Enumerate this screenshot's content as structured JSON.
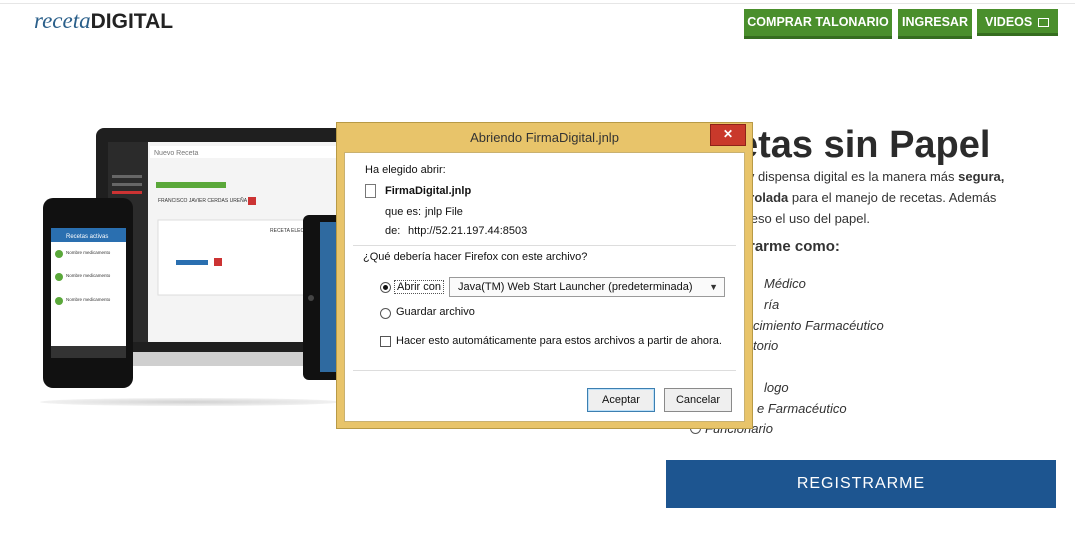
{
  "header": {
    "logo_italic": "receta",
    "logo_bold": "DIGITAL",
    "nav": [
      {
        "label": "COMPRAR TALONARIO"
      },
      {
        "label": "INGRESAR"
      },
      {
        "label": "VIDEOS"
      }
    ]
  },
  "hero": {
    "title": "etas sin Papel",
    "desc_1": "n y dispensa digital es la manera más ",
    "desc_bold_1": "segura,",
    "desc_bold_2": "ntrolada",
    "desc_2": " para el manejo de recetas. Además",
    "desc_3": "oceso el uso del papel."
  },
  "register": {
    "heading": "trarme como:",
    "options": [
      "Médico",
      "ría",
      "cimiento Farmacéutico",
      "torio",
      "logo",
      "e Farmacéutico",
      "Funcionario"
    ],
    "button_label": "REGISTRARME"
  },
  "mockup": {
    "app_header": "Nuevo Receta",
    "patient_name": "FRANCISCO JAVIER CERDAS UREÑA",
    "panel_title": "RECETA ELECTR",
    "phone_header": "Recetas activas",
    "phone_item_label": "Nombre medicamento"
  },
  "dialog": {
    "title": "Abriendo FirmaDigital.jnlp",
    "close_glyph": "✕",
    "chose_to_open": "Ha elegido abrir:",
    "filename": "FirmaDigital.jnlp",
    "type_label": "que es:",
    "type_value": "jnlp File",
    "from_label": "de:",
    "from_value": "http://52.21.197.44:8503",
    "question": "¿Qué debería hacer Firefox con este archivo?",
    "open_with_label": "Abrir con",
    "open_with_app": "Java(TM) Web Start Launcher (predeterminada)",
    "save_label": "Guardar archivo",
    "auto_label": "Hacer esto automáticamente para estos archivos a partir de ahora.",
    "ok_label": "Aceptar",
    "cancel_label": "Cancelar"
  },
  "colors": {
    "nav_green": "#4a8f2c",
    "register_blue": "#1d5590",
    "dialog_frame": "#e8c46a",
    "close_red": "#c9392b"
  }
}
